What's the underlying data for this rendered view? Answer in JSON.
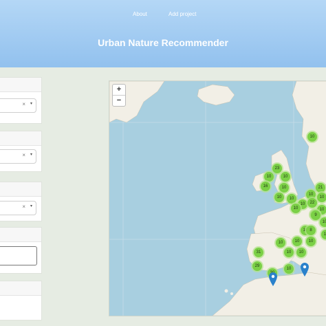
{
  "nav": {
    "about": "About",
    "add_project": "Add project"
  },
  "header": {
    "title": "Urban Nature Recommender"
  },
  "sidebar": {
    "filters": [
      {
        "clear_glyph": "×",
        "arrow_glyph": "▾"
      },
      {
        "clear_glyph": "×",
        "arrow_glyph": "▾"
      },
      {
        "clear_glyph": "×",
        "arrow_glyph": "▾"
      }
    ]
  },
  "map": {
    "zoom_in": "+",
    "zoom_out": "−",
    "clusters": [
      "10",
      "23",
      "10",
      "16",
      "10",
      "10",
      "10",
      "10",
      "10",
      "10",
      "21",
      "10",
      "22",
      "10",
      "10",
      "10",
      "10",
      "10",
      "9",
      "10",
      "10",
      "10",
      "8",
      "10",
      "31",
      "10",
      "10",
      "29",
      "10",
      "30"
    ],
    "markers": [
      "location-marker",
      "location-marker"
    ]
  },
  "colors": {
    "header": "#92c1ee",
    "cluster": "#7bd046",
    "marker": "#2a81cb",
    "sea": "#a8cfe0",
    "land": "#f2efe6"
  }
}
